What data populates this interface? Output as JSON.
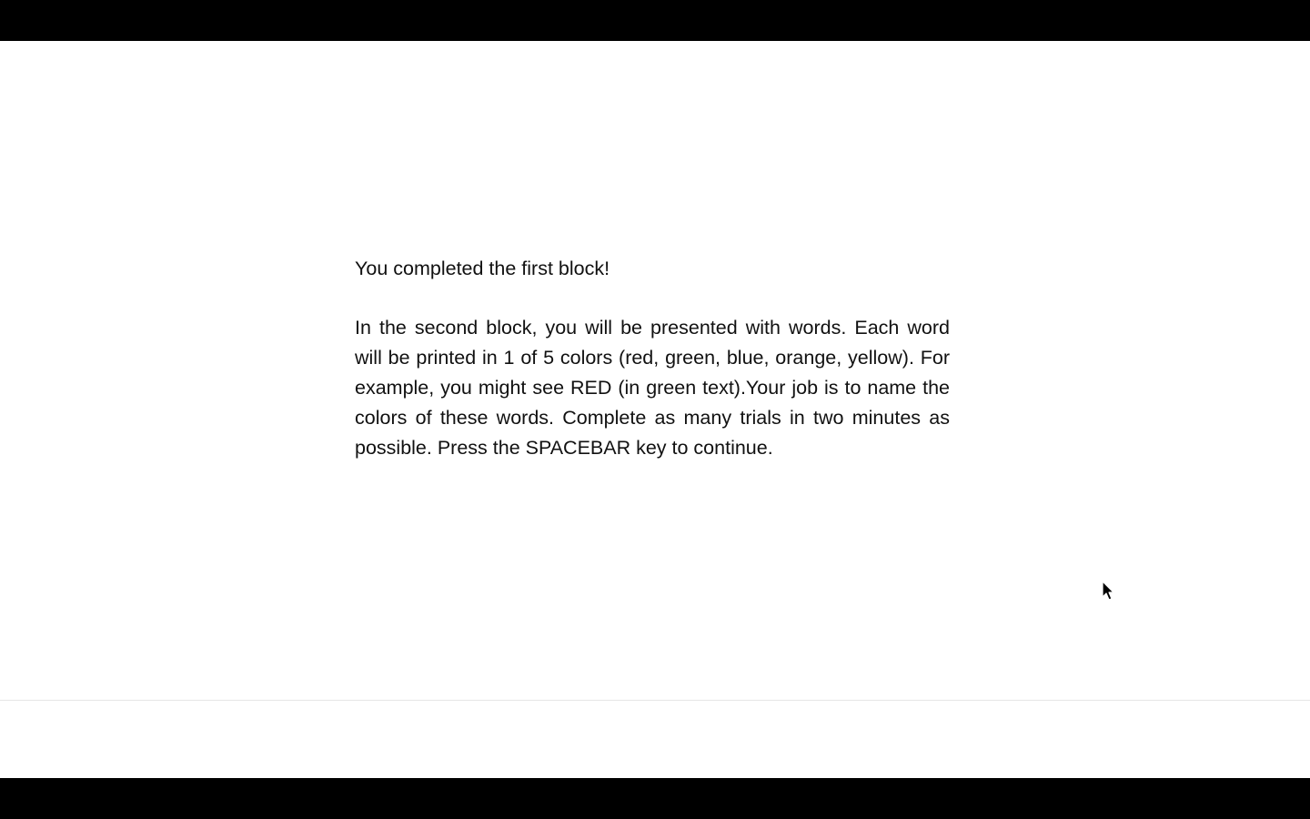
{
  "instructions": {
    "intro": "You completed the first block!",
    "body": "In the second block, you will be presented with words. Each word will be printed in 1 of 5 colors (red, green, blue, orange, yellow). For example, you might see RED (in green text).Your job is to name the colors of these words. Complete as many trials in two minutes as possible. Press the SPACEBAR key to continue."
  },
  "icons": {
    "cursor": "mouse-pointer-icon"
  },
  "colors": {
    "background": "#ffffff",
    "text": "#111111",
    "letterbox": "#000000"
  }
}
